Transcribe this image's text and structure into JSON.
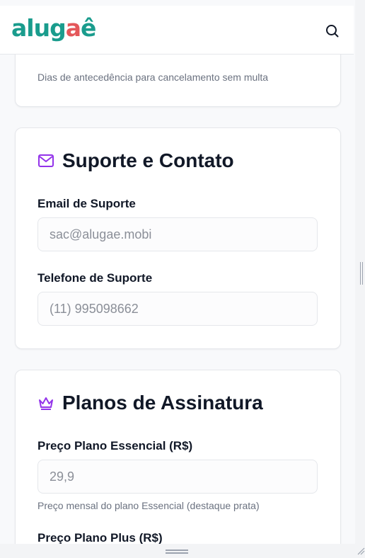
{
  "header": {
    "logo_part1": "alug",
    "logo_part2": "a",
    "logo_part3": "ê",
    "search_label": "search"
  },
  "cancellation": {
    "hint": "Dias de antecedência para cancelamento sem multa"
  },
  "support": {
    "title": "Suporte e Contato",
    "email_label": "Email de Suporte",
    "email_placeholder": "sac@alugae.mobi",
    "phone_label": "Telefone de Suporte",
    "phone_placeholder": "(11) 995098662"
  },
  "plans": {
    "title": "Planos de Assinatura",
    "essential_label": "Preço Plano Essencial (R$)",
    "essential_placeholder": "29,9",
    "essential_hint": "Preço mensal do plano Essencial (destaque prata)",
    "plus_label": "Preço Plano Plus (R$)"
  },
  "colors": {
    "brand_teal": "#1a9c8d",
    "brand_coral": "#e4575a",
    "icon_purple": "#9333ea"
  },
  "icons": [
    "search-icon",
    "mail-icon",
    "crown-icon"
  ]
}
